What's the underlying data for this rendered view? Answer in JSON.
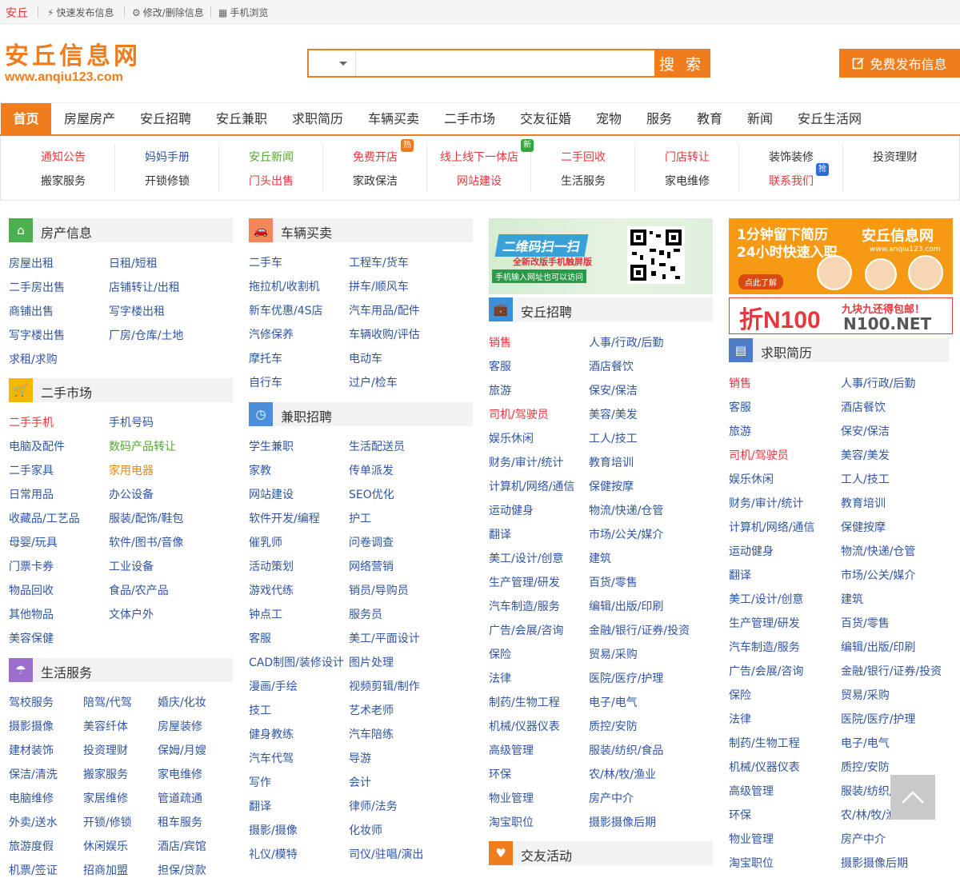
{
  "topbar": {
    "city": "安丘",
    "quick_post": "快速发布信息",
    "edit_delete": "修改/删除信息",
    "mobile": "手机浏览"
  },
  "logo": {
    "cn": "安丘信息网",
    "url": "www.anqiu123.com"
  },
  "search": {
    "value": "",
    "button": "搜 索"
  },
  "post_button": "免费发布信息",
  "nav": [
    "首页",
    "房屋房产",
    "安丘招聘",
    "安丘兼职",
    "求职简历",
    "车辆买卖",
    "二手市场",
    "交友征婚",
    "宠物",
    "服务",
    "教育",
    "新闻",
    "安丘生活网"
  ],
  "subnav": [
    {
      "a": "通知公告",
      "b": "搬家服务"
    },
    {
      "a": "妈妈手册",
      "b": "开锁修锁"
    },
    {
      "a": "安丘新闻",
      "b": "门头出售"
    },
    {
      "a": "免费开店",
      "b": "家政保洁",
      "badge": "热"
    },
    {
      "a": "线上线下一体店",
      "b": "网站建设",
      "badge": "新"
    },
    {
      "a": "二手回收",
      "b": "生活服务"
    },
    {
      "a": "门店转让",
      "b": "家电维修"
    },
    {
      "a": "装饰装修",
      "b": "联系我们",
      "badge": "抢"
    },
    {
      "a": "投资理财",
      "b": ""
    }
  ],
  "colors": {
    "accent": "#f07d1d",
    "link": "#2f55a4",
    "red": "#e4393c",
    "green": "#55a532"
  },
  "sections": {
    "house": {
      "title": "房产信息",
      "icon": "home-icon",
      "items": [
        "房屋出租",
        "日租/短租",
        "二手房出售",
        "店铺转让/出租",
        "商铺出售",
        "写字楼出租",
        "写字楼出售",
        "厂房/仓库/土地",
        "求租/求购"
      ]
    },
    "market": {
      "title": "二手市场",
      "icon": "cart-icon",
      "items": [
        "二手手机",
        "手机号码",
        "电脑及配件",
        "数码产品转让",
        "二手家具",
        "家用电器",
        "日常用品",
        "办公设备",
        "收藏品/工艺品",
        "服装/配饰/鞋包",
        "母婴/玩具",
        "软件/图书/音像",
        "门票卡券",
        "工业设备",
        "物品回收",
        "食品/农产品",
        "其他物品",
        "文体户外",
        "美容保健"
      ]
    },
    "life": {
      "title": "生活服务",
      "icon": "umbrella-icon",
      "items": [
        "驾校服务",
        "陪驾/代驾",
        "婚庆/化妆",
        "摄影摄像",
        "美容纤体",
        "房屋装修",
        "建材装饰",
        "投资理财",
        "保姆/月嫂",
        "保洁/清洗",
        "搬家服务",
        "家电维修",
        "电脑维修",
        "家居维修",
        "管道疏通",
        "外卖/送水",
        "开锁/修锁",
        "租车服务",
        "旅游度假",
        "休闲娱乐",
        "酒店/宾馆",
        "机票/签证",
        "招商加盟",
        "担保/贷款"
      ]
    },
    "cars": {
      "title": "车辆买卖",
      "icon": "car-icon",
      "items": [
        "二手车",
        "工程车/货车",
        "拖拉机/收割机",
        "拼车/顺风车",
        "新车优惠/4S店",
        "汽车用品/配件",
        "汽修保养",
        "车辆收购/评估",
        "摩托车",
        "电动车",
        "自行车",
        "过户/检车"
      ]
    },
    "parttime": {
      "title": "兼职招聘",
      "icon": "clock-icon",
      "items": [
        "学生兼职",
        "生活配送员",
        "家教",
        "传单派发",
        "网站建设",
        "SEO优化",
        "软件开发/编程",
        "护工",
        "催乳师",
        "问卷调查",
        "活动策划",
        "网络营销",
        "游戏代练",
        "销员/导购员",
        "钟点工",
        "服务员",
        "客服",
        "美工/平面设计",
        "CAD制图/装修设计",
        "图片处理",
        "漫画/手绘",
        "视频剪辑/制作",
        "技工",
        "艺术老师",
        "健身教练",
        "汽车陪练",
        "汽车代驾",
        "导游",
        "写作",
        "会计",
        "翻译",
        "律师/法务",
        "摄影/摄像",
        "化妆师",
        "礼仪/模特",
        "司仪/驻唱/演出"
      ]
    },
    "jobs": {
      "title": "安丘招聘",
      "icon": "briefcase-icon",
      "items": [
        "销售",
        "人事/行政/后勤",
        "客服",
        "酒店餐饮",
        "旅游",
        "保安/保洁",
        "司机/驾驶员",
        "美容/美发",
        "娱乐休闲",
        "工人/技工",
        "财务/审计/统计",
        "教育培训",
        "计算机/网络/通信",
        "保健按摩",
        "运动健身",
        "物流/快递/仓管",
        "翻译",
        "市场/公关/媒介",
        "美工/设计/创意",
        "建筑",
        "生产管理/研发",
        "百货/零售",
        "汽车制造/服务",
        "编辑/出版/印刷",
        "广告/会展/咨询",
        "金融/银行/证券/投资",
        "保险",
        "贸易/采购",
        "法律",
        "医院/医疗/护理",
        "制药/生物工程",
        "电子/电气",
        "机械/仪器仪表",
        "质控/安防",
        "高级管理",
        "服装/纺织/食品",
        "环保",
        "农/林/牧/渔业",
        "物业管理",
        "房产中介",
        "淘宝职位",
        "摄影摄像后期"
      ]
    },
    "dating": {
      "title": "交友活动",
      "icon": "heart-icon"
    },
    "resume": {
      "title": "求职简历",
      "icon": "resume-icon",
      "items": [
        "销售",
        "人事/行政/后勤",
        "客服",
        "酒店餐饮",
        "旅游",
        "保安/保洁",
        "司机/驾驶员",
        "美容/美发",
        "娱乐休闲",
        "工人/技工",
        "财务/审计/统计",
        "教育培训",
        "计算机/网络/通信",
        "保健按摩",
        "运动健身",
        "物流/快递/仓管",
        "翻译",
        "市场/公关/媒介",
        "美工/设计/创意",
        "建筑",
        "生产管理/研发",
        "百货/零售",
        "汽车制造/服务",
        "编辑/出版/印刷",
        "广告/会展/咨询",
        "金融/银行/证券/投资",
        "保险",
        "贸易/采购",
        "法律",
        "医院/医疗/护理",
        "制药/生物工程",
        "电子/电气",
        "机械/仪器仪表",
        "质控/安防",
        "高级管理",
        "服装/纺织/食品",
        "环保",
        "农/林/牧/渔业",
        "物业管理",
        "房产中介",
        "淘宝职位",
        "摄影摄像后期"
      ]
    }
  },
  "banners": {
    "qr": {
      "line1": "二维码扫一扫",
      "line2": "全新改版手机触屏版",
      "line3": "手机输入网址也可以访问"
    },
    "resume_ad": {
      "line1": "1分钟留下简历",
      "line2": "24小时快速入职",
      "brand": "安丘信息网",
      "url": "www.anqiu123.com",
      "btn": "点此了解"
    },
    "n100": {
      "logo": "折N100",
      "slogan": "九块九还得包邮！",
      "url": "N100.NET"
    }
  }
}
